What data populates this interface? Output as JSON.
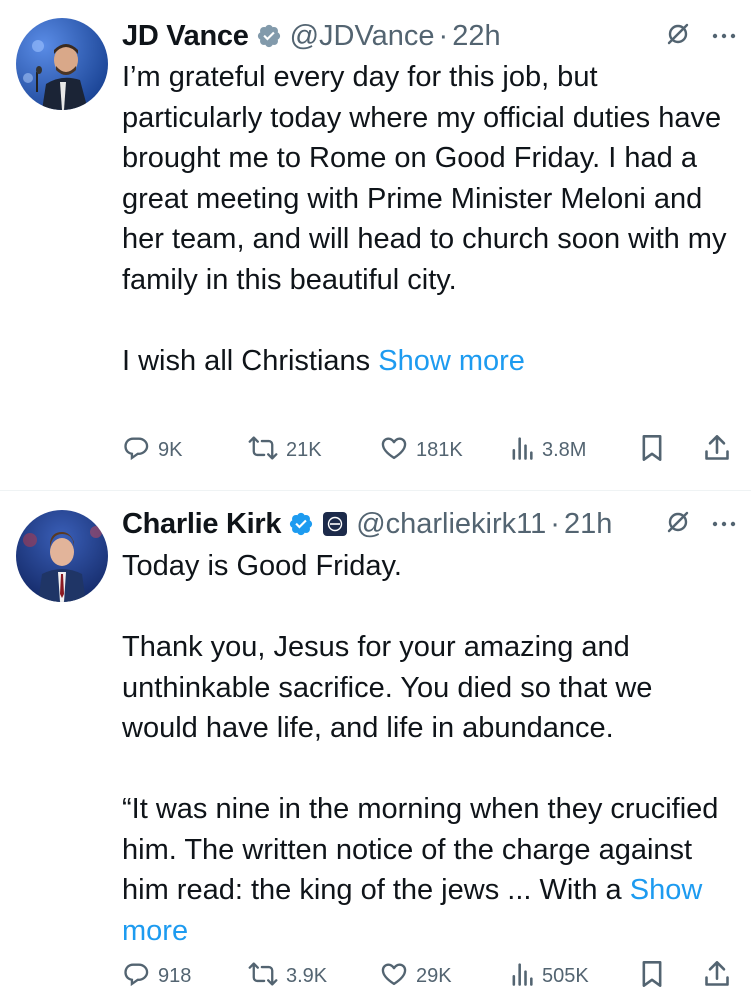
{
  "tweets": [
    {
      "name": "JD Vance",
      "handle": "@JDVance",
      "separator": "·",
      "time": "22h",
      "body": "I’m grateful every day for this job, but particularly today where my official duties have brought me to Rome on Good Friday. I had a great meeting with Prime Minister Meloni and her team, and will head to church soon with my family in this beautiful city.\n\nI wish all Christians ",
      "show_more": "Show more",
      "metrics": {
        "replies": "9K",
        "reposts": "21K",
        "likes": "181K",
        "views": "3.8M"
      },
      "verified_badge_color": "#829aab"
    },
    {
      "name": "Charlie Kirk",
      "handle": "@charliekirk11",
      "separator": "·",
      "time": "21h",
      "body": "Today is Good Friday.\n\nThank you, Jesus for your amazing and unthinkable sacrifice. You died so that we would have life, and life in abundance.\n\n“It was nine in the morning when they crucified him. The written notice of the charge against him read: the king of the jews ... With a ",
      "show_more": "Show more",
      "metrics": {
        "replies": "918",
        "reposts": "3.9K",
        "likes": "29K",
        "views": "505K"
      },
      "verified_badge_color": "#1d9bf0"
    }
  ],
  "colors": {
    "text": "#0f1419",
    "secondary": "#536471",
    "link": "#1d9bf0"
  },
  "icons": [
    "grok-icon",
    "more-icon",
    "reply-icon",
    "repost-icon",
    "like-icon",
    "views-icon",
    "bookmark-icon",
    "share-icon",
    "verified-badge-icon"
  ]
}
